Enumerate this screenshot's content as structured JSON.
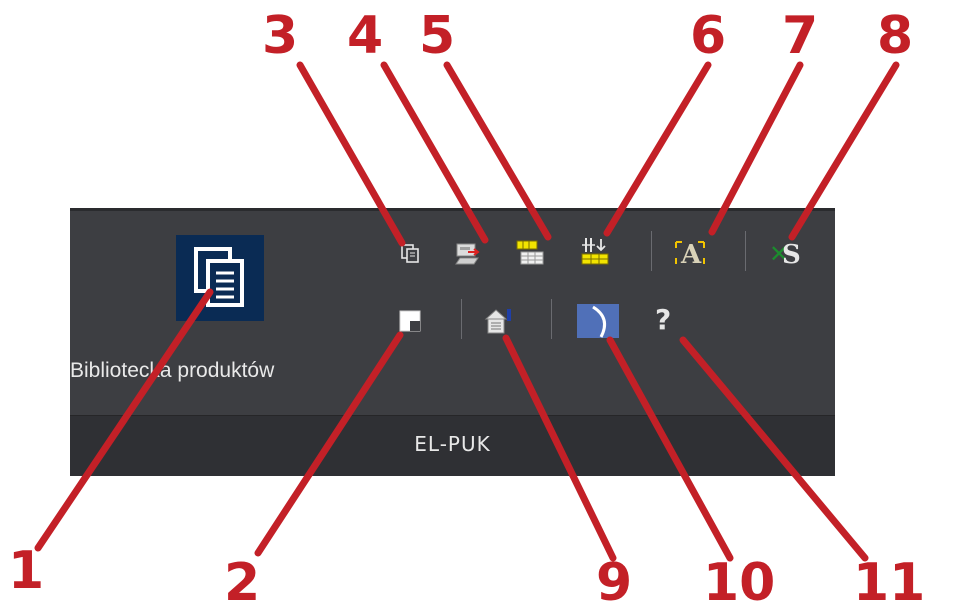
{
  "ribbon": {
    "group_label": "EL-PUK",
    "big_button_label": "Bibliotecka produktów"
  },
  "icons": {
    "library": "library-icon",
    "copy": "copy-icon",
    "export": "export-icon",
    "table_replace": "table-replace-icon",
    "table_sort": "table-sort-icon",
    "text_style": "text-style-icon",
    "excel": "excel-icon",
    "window": "window-icon",
    "properties": "properties-icon",
    "arc": "arc-icon",
    "help": "help-icon"
  },
  "callouts": [
    "1",
    "2",
    "3",
    "4",
    "5",
    "6",
    "7",
    "8",
    "9",
    "10",
    "11"
  ],
  "colors": {
    "panel": "#3d3e42",
    "footer": "#2f3034",
    "accent": "#c32027",
    "icon_blue": "#0a2b54"
  }
}
